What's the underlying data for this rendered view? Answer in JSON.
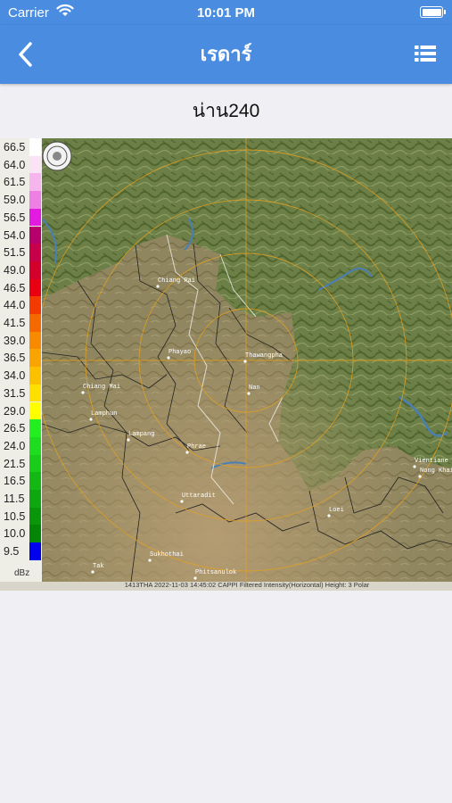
{
  "status": {
    "carrier": "Carrier",
    "time": "10:01 PM"
  },
  "nav": {
    "title": "เรดาร์",
    "back_icon": "chevron-left-icon",
    "menu_icon": "list-icon"
  },
  "page": {
    "subtitle": "น่าน240"
  },
  "legend": {
    "unit": "dBz",
    "levels": [
      {
        "label": "66.5",
        "color": "#ffffff"
      },
      {
        "label": "64.0",
        "color": "#fbe3f6"
      },
      {
        "label": "61.5",
        "color": "#f7b5ee"
      },
      {
        "label": "59.0",
        "color": "#f07fe5"
      },
      {
        "label": "56.5",
        "color": "#e31adf"
      },
      {
        "label": "54.0",
        "color": "#b8006c"
      },
      {
        "label": "51.5",
        "color": "#c8004a"
      },
      {
        "label": "49.0",
        "color": "#d4002c"
      },
      {
        "label": "46.5",
        "color": "#e80012"
      },
      {
        "label": "44.0",
        "color": "#f43a00"
      },
      {
        "label": "41.5",
        "color": "#f56a00"
      },
      {
        "label": "39.0",
        "color": "#f78a00"
      },
      {
        "label": "36.5",
        "color": "#f9a400"
      },
      {
        "label": "34.0",
        "color": "#fbc000"
      },
      {
        "label": "31.5",
        "color": "#fde000"
      },
      {
        "label": "29.0",
        "color": "#ffff00"
      },
      {
        "label": "26.5",
        "color": "#22ee22"
      },
      {
        "label": "24.0",
        "color": "#1edd1e"
      },
      {
        "label": "21.5",
        "color": "#19cc19"
      },
      {
        "label": "16.5",
        "color": "#14b814"
      },
      {
        "label": "11.5",
        "color": "#0fa70f"
      },
      {
        "label": "10.5",
        "color": "#0a960a"
      },
      {
        "label": "10.0",
        "color": "#058505"
      },
      {
        "label": "9.5",
        "color": "#0000ee"
      }
    ]
  },
  "map": {
    "cities": [
      {
        "name": "Chiang Rai"
      },
      {
        "name": "Phayao"
      },
      {
        "name": "Chiang Mai"
      },
      {
        "name": "Lamphun"
      },
      {
        "name": "Lampang"
      },
      {
        "name": "Phrae"
      },
      {
        "name": "Nan"
      },
      {
        "name": "Thawangpha"
      },
      {
        "name": "Uttaradit"
      },
      {
        "name": "Sukhothai"
      },
      {
        "name": "Phitsanulok"
      },
      {
        "name": "Tak"
      },
      {
        "name": "Loei"
      },
      {
        "name": "Vientiane"
      },
      {
        "name": "Nong Khai"
      }
    ],
    "caption": "1413THA 2022-11-03 14:45:02 CAPPI Filtered Intensity(Horizontal) Height: 3 Polar"
  }
}
